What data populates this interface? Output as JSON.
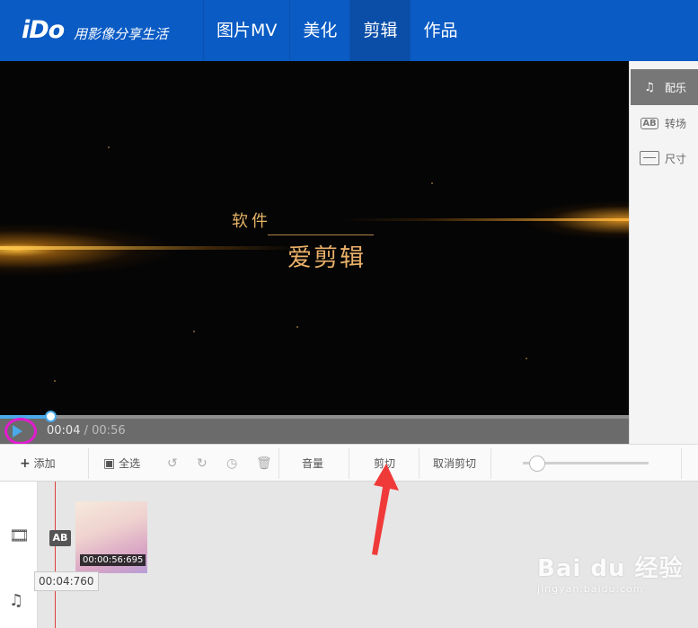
{
  "header": {
    "logo": "iDo",
    "slogan": "用影像分享生活",
    "nav": [
      {
        "label": "图片MV",
        "active": false
      },
      {
        "label": "美化",
        "active": false
      },
      {
        "label": "剪辑",
        "active": true
      },
      {
        "label": "作品",
        "active": false
      }
    ]
  },
  "preview": {
    "title_small": "软件",
    "title_big": "爱剪辑"
  },
  "player": {
    "current_time": "00:04",
    "separator": "/",
    "duration": "00:56",
    "progress_fraction": 0.08
  },
  "sidebar": {
    "items": [
      {
        "label": "配乐",
        "icon": "music-note-icon",
        "active": true
      },
      {
        "label": "转场",
        "icon": "ab-transition-icon",
        "active": false
      },
      {
        "label": "尺寸",
        "icon": "screen-size-icon",
        "active": false
      }
    ]
  },
  "toolbar": {
    "add": "添加",
    "select_all": "全选",
    "volume": "音量",
    "cut": "剪切",
    "cancel_cut": "取消剪切",
    "volume_level": 0.05
  },
  "timeline": {
    "transition_label": "AB",
    "clip_duration": "00:00:56:695",
    "playhead_time": "00:04:760"
  },
  "watermark": {
    "main": "Bai du 经验",
    "sub": "jingyan.baidu.com"
  },
  "colors": {
    "header": "#0a5bc4",
    "accent": "#4aa9e9",
    "highlight_ring": "#e21cd0",
    "arrow": "#f03a3a"
  }
}
